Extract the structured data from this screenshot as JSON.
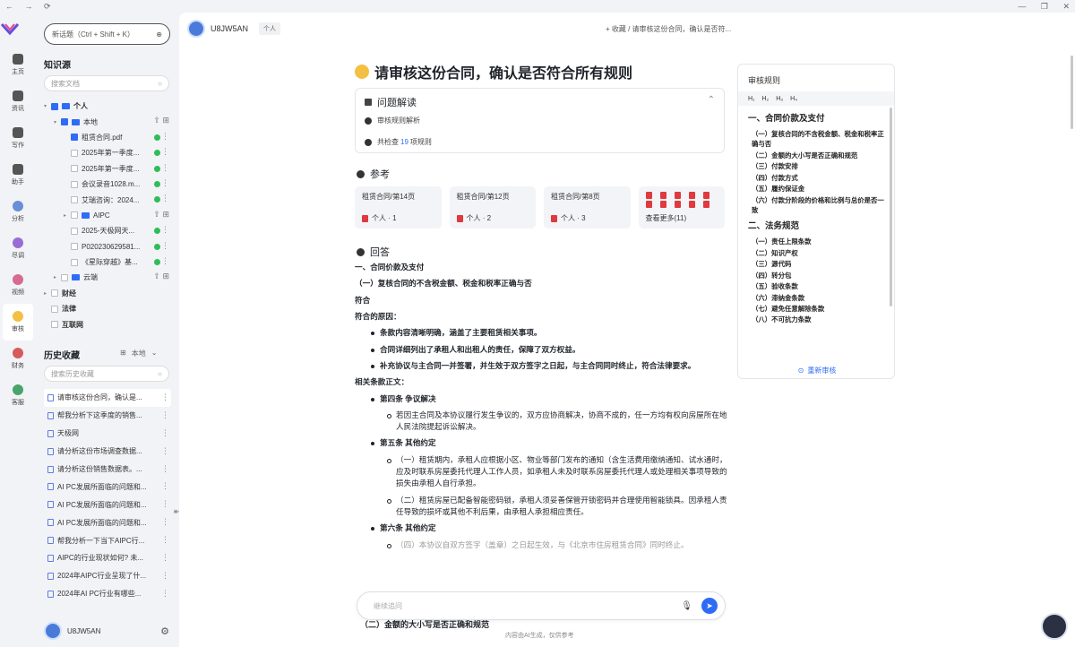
{
  "window": {
    "nav": [
      "←",
      "→",
      "⟳"
    ],
    "controls": [
      "—",
      "❐",
      "✕"
    ]
  },
  "rail": [
    {
      "label": "主页",
      "icon": "home-icon",
      "color": "#555"
    },
    {
      "label": "资讯",
      "icon": "news-icon",
      "color": "#555"
    },
    {
      "label": "写作",
      "icon": "pen-icon",
      "color": "#555"
    },
    {
      "label": "助手",
      "icon": "robot-icon",
      "color": "#555"
    },
    {
      "label": "分析",
      "icon": "analysis-avatar-icon",
      "color": "#6b8fd6"
    },
    {
      "label": "尽调",
      "icon": "research-avatar-icon",
      "color": "#9a6bd6"
    },
    {
      "label": "视频",
      "icon": "video-avatar-icon",
      "color": "#d66b8f"
    },
    {
      "label": "审核",
      "icon": "review-avatar-icon",
      "color": "#f3c044"
    },
    {
      "label": "财务",
      "icon": "finance-avatar-icon",
      "color": "#d65b5b"
    },
    {
      "label": "客服",
      "icon": "service-avatar-icon",
      "color": "#4aa36b"
    }
  ],
  "sidebar": {
    "new_chat": "新话题（Ctrl + Shift + K）",
    "knowledge_title": "知识源",
    "search_docs": "搜索文档",
    "tree": [
      {
        "label": "个人",
        "level": 0,
        "arrow": "▾",
        "check": "part",
        "folder": true,
        "bold": true
      },
      {
        "label": "本地",
        "level": 1,
        "arrow": "▾",
        "check": "part",
        "folder": true,
        "acts": "⇧ ⊞"
      },
      {
        "label": "租赁合同.pdf",
        "level": 2,
        "check": "on",
        "dot": true
      },
      {
        "label": "2025年第一季度...",
        "level": 2,
        "check": "off",
        "dot": true
      },
      {
        "label": "2025年第一季度...",
        "level": 2,
        "check": "off",
        "dot": true
      },
      {
        "label": "会议录音1028.m...",
        "level": 2,
        "check": "off",
        "dot": true
      },
      {
        "label": "艾瑞咨询：2024...",
        "level": 2,
        "check": "off",
        "dot": true
      },
      {
        "label": "AIPC",
        "level": 2,
        "arrow": "▸",
        "check": "off",
        "folder": true,
        "acts": "⇧ ⊞"
      },
      {
        "label": "2025-天极网天...",
        "level": 2,
        "check": "off",
        "dot": true
      },
      {
        "label": "P020230629581...",
        "level": 2,
        "check": "off",
        "dot": true
      },
      {
        "label": "《星际穿越》基...",
        "level": 2,
        "check": "off",
        "dot": true
      },
      {
        "label": "云端",
        "level": 1,
        "arrow": "▸",
        "check": "off",
        "folder": true,
        "acts": "⇧ ⊞"
      },
      {
        "label": "财经",
        "level": 0,
        "arrow": "▸",
        "check": "off",
        "bold": true
      },
      {
        "label": "法律",
        "level": 0,
        "check": "off",
        "bold": true
      },
      {
        "label": "互联网",
        "level": 0,
        "check": "off",
        "bold": true
      }
    ],
    "history_title": "历史收藏",
    "history_scope": "本地",
    "search_history": "搜索历史收藏",
    "history": [
      "请审核这份合同，确认是...",
      "帮我分析下这季度的销售...",
      "天极网",
      "请分析这份市场调查数据...",
      "请分析这份销售数据表。...",
      "AI PC发展所面临的问题和...",
      "AI PC发展所面临的问题和...",
      "AI PC发展所面临的问题和...",
      "帮我分析一下当下AIPC行...",
      "AIPC的行业现状如何? 未...",
      "2024年AIPC行业呈现了什...",
      "2024年AI PC行业有哪些..."
    ],
    "user": "U8JW5AN"
  },
  "topbar": {
    "user": "U8JW5AN",
    "tag": "个人",
    "crumb": "+ 收藏  /  请审核这份合同，确认是否符..."
  },
  "main": {
    "title": "请审核这份合同，确认是否符合所有规则",
    "problem": {
      "heading": "问题解读",
      "step1": "审核规则解析",
      "step2_pre": "共检查",
      "step2_num": "19",
      "step2_post": "项规则"
    },
    "refs_heading": "参考",
    "refs": [
      {
        "title": "租赁合同/第14页",
        "source": "个人 · 1"
      },
      {
        "title": "租赁合同/第12页",
        "source": "个人 · 2"
      },
      {
        "title": "租赁合同/第8页",
        "source": "个人 · 3"
      }
    ],
    "refs_more": "查看更多(11)",
    "answer_heading": "回答",
    "answer": {
      "h1": "一、合同价款及支付",
      "h2": "（一）复核合同的不含税金额、税金和税率正确与否",
      "verdict": "符合",
      "reason_title": "符合的原因：",
      "reasons": [
        "条款内容清晰明确，涵盖了主要租赁相关事项。",
        "合同详细列出了承租人和出租人的责任，保障了双方权益。",
        "补充协议与主合同一并签署，并生效于双方签字之日起，与主合同同时终止，符合法律要求。"
      ],
      "clauses_title": "相关条款正文：",
      "c4": "第四条 争议解决",
      "c4_text": "若因主合同及本协议履行发生争议的，双方应协商解决，协商不成的，任一方均有权向房屋所在地人民法院提起诉讼解决。",
      "c5": "第五条 其他约定",
      "c5_a": "（一）租赁期内，承租人应根据小区、物业等部门发布的通知（含生活费用缴纳通知、试水通时，应及时联系房屋委托代理人工作人员，如承租人未及时联系房屋委托代理人或处理相关事项导致的损失由承租人自行承担。",
      "c5_b": "（二）租赁房屋已配备智能密码锁，承租人须妥善保管开锁密码并合理使用智能锁具。因承租人责任导致的损坏或其他不利后果，由承租人承担相应责任。",
      "c6": "第六条 其他约定",
      "c6_partial": "（四）本协议自双方签字（盖章）之日起生效，与《北京市住房租赁合同》同时终止。",
      "behind": "（二）金额的大小写是否正确和规范"
    },
    "input_placeholder": "继续追问",
    "footer": "内容由AI生成，仅供参考"
  },
  "panel": {
    "title": "审核规则",
    "levels": [
      "H₁",
      "H₂",
      "H₃",
      "H₄"
    ],
    "sections": [
      {
        "title": "一、合同价款及支付",
        "items": [
          "（一）复核合同的不含税金额、税金和税率正确与否",
          "（二）金额的大小写是否正确和规范",
          "（三）付款安排",
          "（四）付款方式",
          "（五）履约保证金",
          "（六）付款分阶段的价格和比例与总价是否一致"
        ]
      },
      {
        "title": "二、法务规范",
        "items": [
          "（一）责任上限条款",
          "（二）知识产权",
          "（三）源代码",
          "（四）转分包",
          "（五）验收条款",
          "（六）滞纳金条款",
          "（七）避免任意解除条款",
          "（八）不可抗力条款"
        ]
      }
    ],
    "rerun": "重新审核"
  }
}
